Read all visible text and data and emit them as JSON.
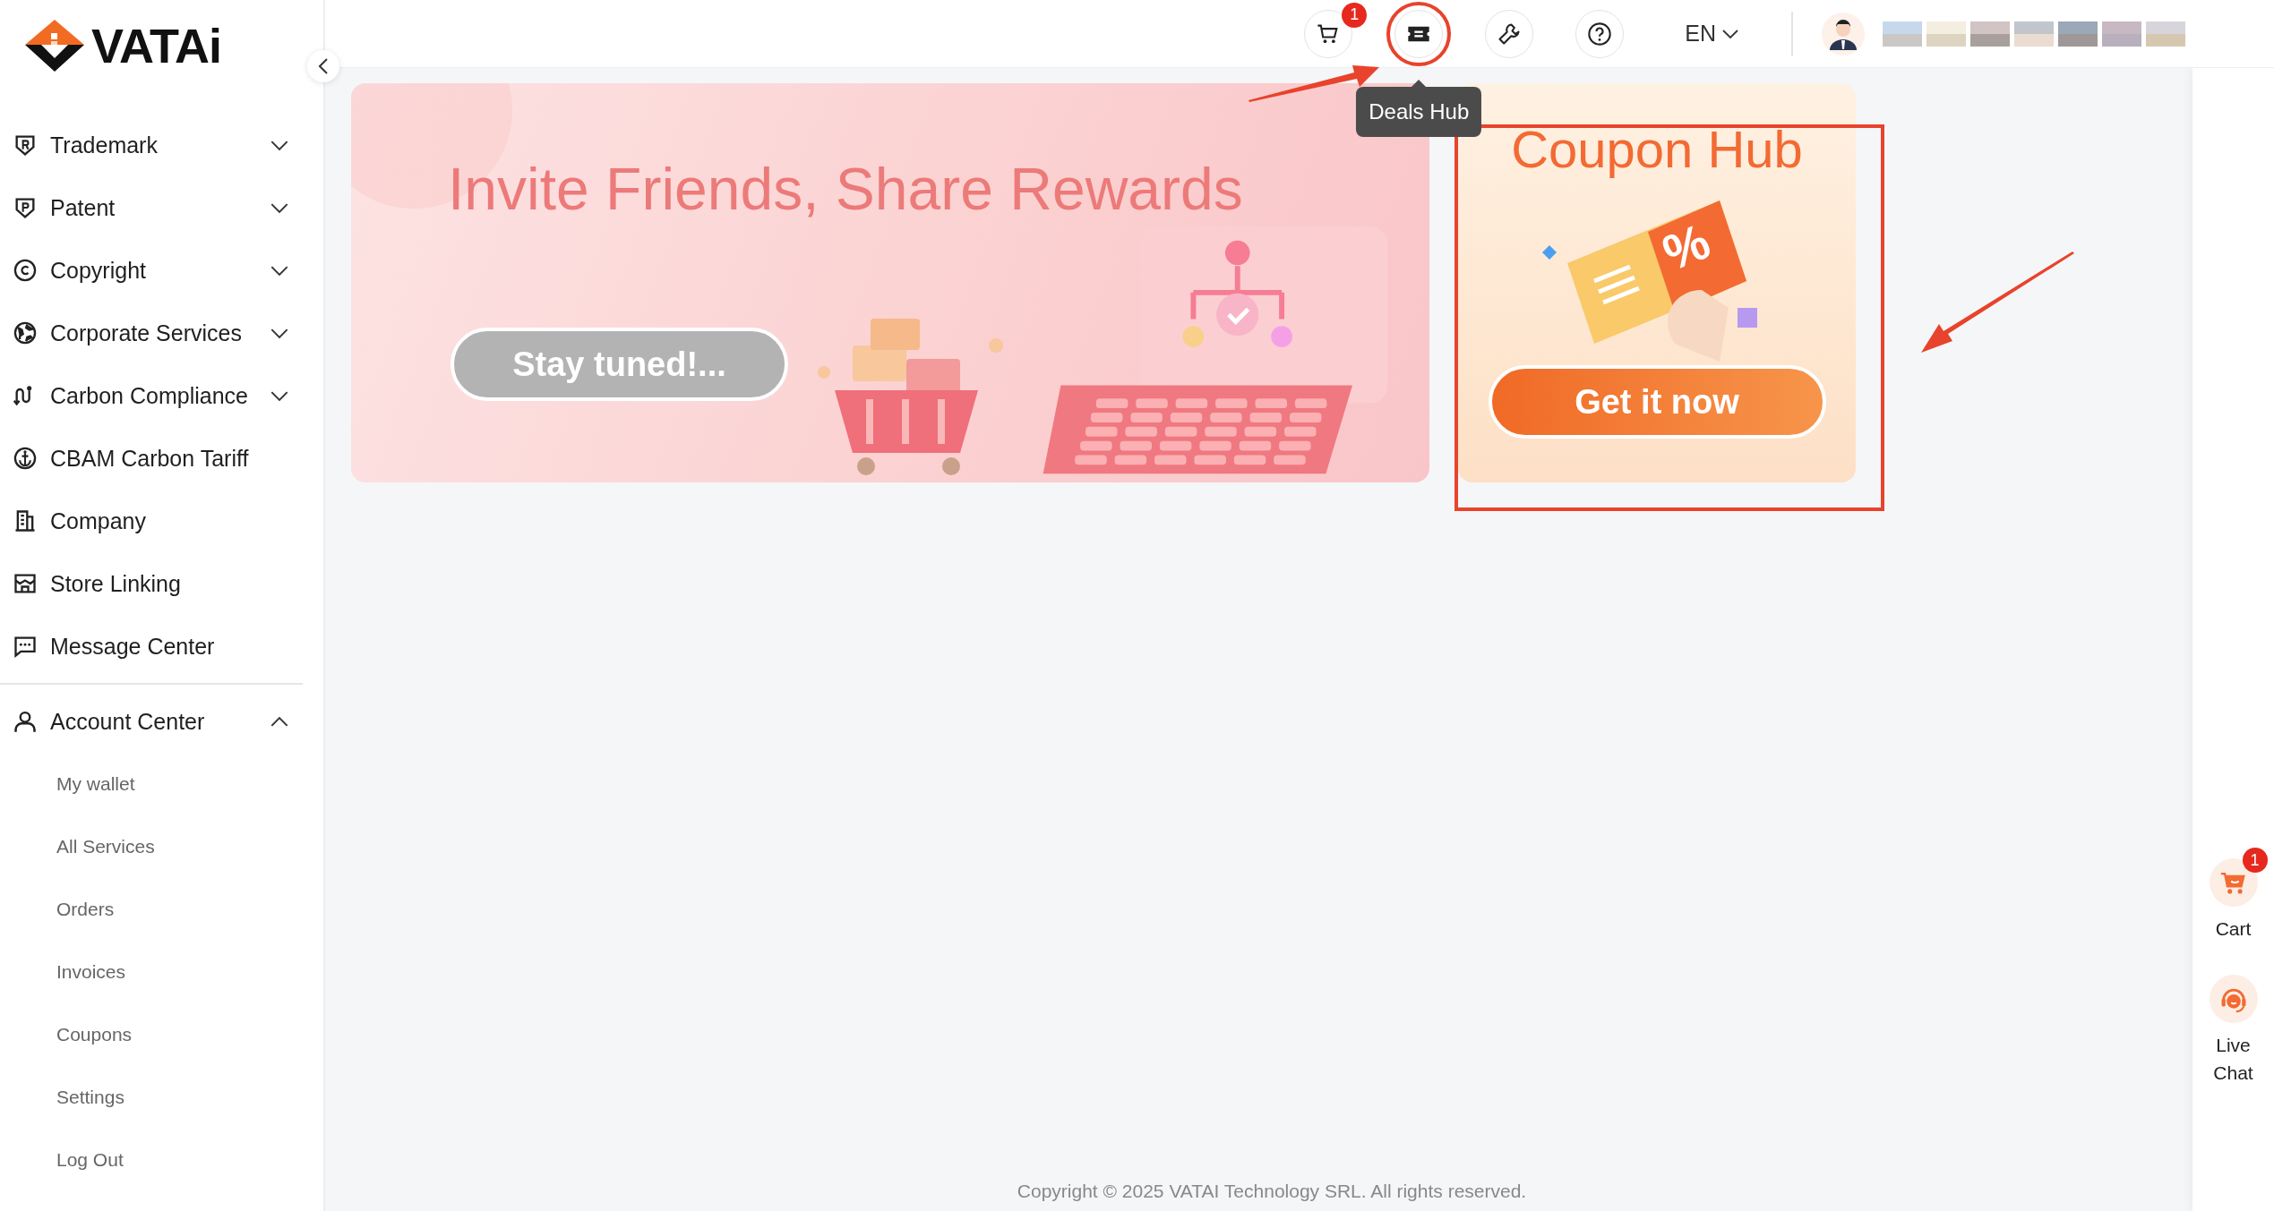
{
  "logo": {
    "text": "VATAi"
  },
  "sidebar": {
    "items": [
      {
        "kind": "trademark",
        "label": "Trademark",
        "expanded": false
      },
      {
        "kind": "patent",
        "label": "Patent",
        "expanded": false
      },
      {
        "kind": "copyright",
        "label": "Copyright",
        "expanded": false
      },
      {
        "kind": "globe",
        "label": "Corporate Services",
        "expanded": false
      },
      {
        "kind": "route",
        "label": "Carbon Compliance",
        "expanded": false
      },
      {
        "kind": "anchor",
        "label": "CBAM Carbon Tariff"
      },
      {
        "kind": "building",
        "label": "Company"
      },
      {
        "kind": "store",
        "label": "Store Linking"
      },
      {
        "kind": "message",
        "label": "Message Center"
      }
    ],
    "account": {
      "kind": "user",
      "label": "Account Center",
      "expanded": true,
      "children": [
        {
          "label": "My wallet"
        },
        {
          "label": "All Services"
        },
        {
          "label": "Orders"
        },
        {
          "label": "Invoices"
        },
        {
          "label": "Coupons"
        },
        {
          "label": "Settings"
        },
        {
          "label": "Log Out"
        }
      ]
    }
  },
  "header": {
    "icons": [
      {
        "kind": "cart",
        "badge": "1",
        "highlighted": false
      },
      {
        "kind": "ticket",
        "highlighted": true,
        "tooltip": "Deals Hub"
      },
      {
        "kind": "wrench",
        "highlighted": false
      },
      {
        "kind": "help",
        "highlighted": false
      }
    ],
    "language": "EN"
  },
  "banners": {
    "invite": {
      "title": "Invite Friends, Share Rewards",
      "button": "Stay tuned!..."
    },
    "coupon": {
      "title": "Coupon Hub",
      "art_text": "%",
      "button": "Get it now",
      "highlighted": true
    }
  },
  "right_rail": [
    {
      "kind": "cart",
      "label": "Cart",
      "badge": "1"
    },
    {
      "kind": "chat",
      "label": "Live Chat"
    }
  ],
  "footer": {
    "copyright": "Copyright © 2025 VATAI Technology SRL. All rights reserved."
  }
}
